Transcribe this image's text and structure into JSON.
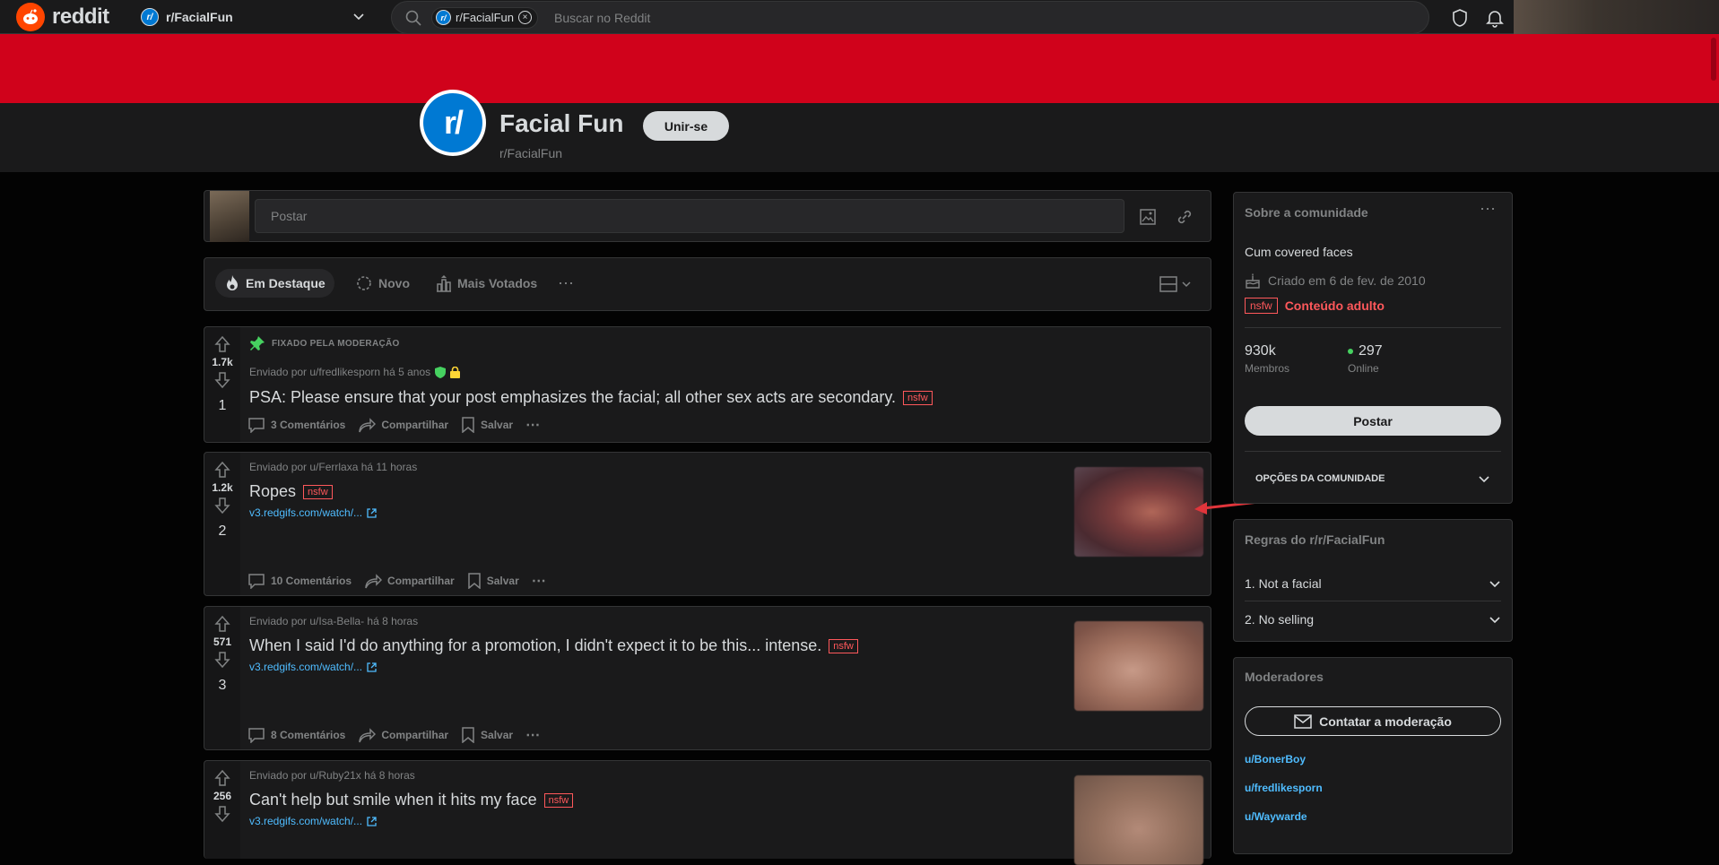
{
  "header": {
    "logo_text": "reddit",
    "community_selector": "r/FacialFun",
    "search_chip": "r/FacialFun",
    "search_placeholder": "Buscar no Reddit"
  },
  "community": {
    "icon_text": "r/",
    "title": "Facial Fun",
    "name": "r/FacialFun",
    "join_label": "Unir-se"
  },
  "create_post": {
    "placeholder": "Postar"
  },
  "sort": {
    "hot": "Em Destaque",
    "new": "Novo",
    "top": "Mais Votados"
  },
  "posts": [
    {
      "pinned_label": "FIXADO PELA MODERAÇÃO",
      "votes": "1.7k",
      "rank": "1",
      "meta": "Enviado por  u/fredlikesporn há 5 anos",
      "title": "PSA: Please ensure that your post emphasizes the facial; all other sex acts are secondary.",
      "nsfw": "nsfw",
      "comments": "3 Comentários",
      "share": "Compartilhar",
      "save": "Salvar"
    },
    {
      "votes": "1.2k",
      "rank": "2",
      "meta": "Enviado por  u/Ferrlaxa há 11 horas",
      "title": "Ropes",
      "nsfw": "nsfw",
      "link": "v3.redgifs.com/watch/...",
      "comments": "10 Comentários",
      "share": "Compartilhar",
      "save": "Salvar"
    },
    {
      "votes": "571",
      "rank": "3",
      "meta": "Enviado por  u/Isa-Bella- há 8 horas",
      "title": "When I said I'd do anything for a promotion, I didn't expect it to be this... intense.",
      "nsfw": "nsfw",
      "link": "v3.redgifs.com/watch/...",
      "comments": "8 Comentários",
      "share": "Compartilhar",
      "save": "Salvar"
    },
    {
      "votes": "256",
      "meta": "Enviado por  u/Ruby21x há 8 horas",
      "title": "Can't help but smile when it hits my face",
      "nsfw": "nsfw",
      "link": "v3.redgifs.com/watch/..."
    }
  ],
  "about": {
    "heading": "Sobre a comunidade",
    "description": "Cum covered faces",
    "created": "Criado em 6 de fev. de 2010",
    "nsfw_tag": "nsfw",
    "adult_label": "Conteúdo adulto",
    "members_count": "930k",
    "members_label": "Membros",
    "online_count": "297",
    "online_label": "Online",
    "post_button": "Postar",
    "options_label": "OPÇÕES DA COMUNIDADE"
  },
  "rules": {
    "heading": "Regras do r/r/FacialFun",
    "items": [
      "1. Not a facial",
      "2. No selling"
    ]
  },
  "moderators": {
    "heading": "Moderadores",
    "contact_button": "Contatar a moderação",
    "list": [
      "u/BonerBoy",
      "u/fredlikesporn",
      "u/Waywarde"
    ]
  },
  "colors": {
    "brand": "#ff4500",
    "banner": "#d0021b",
    "link": "#4fbcff",
    "nsfw": "#ff585b",
    "annotation_arrow": "#e0353b"
  }
}
